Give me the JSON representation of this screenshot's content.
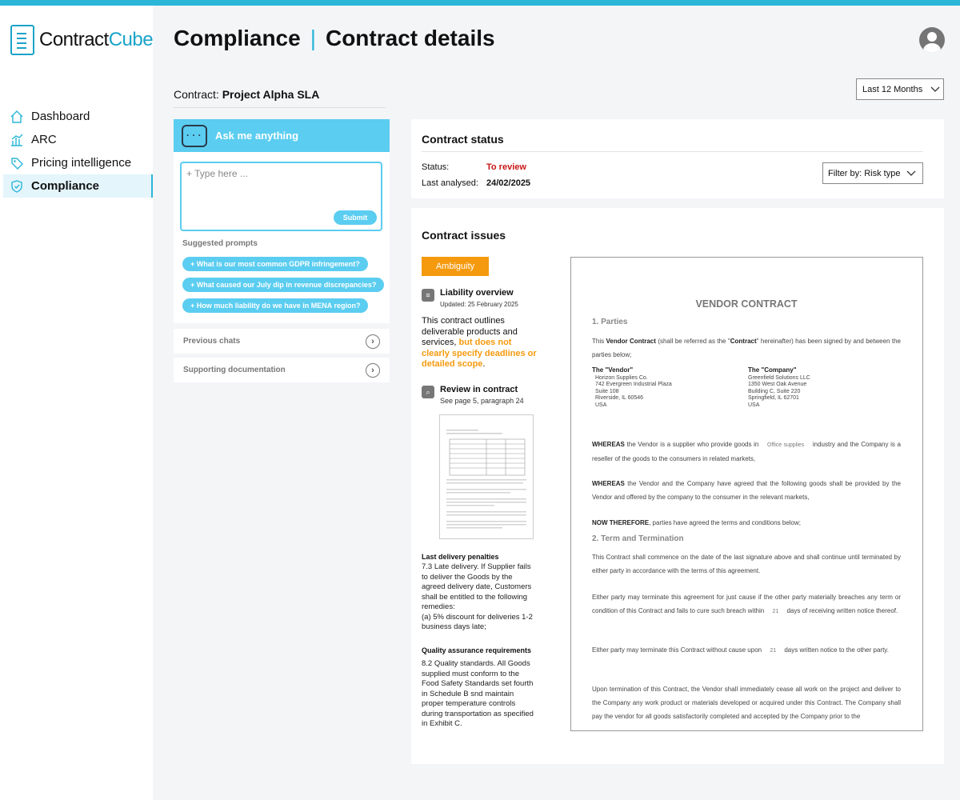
{
  "app": {
    "logo_part1": "Contract",
    "logo_part2": "Cube"
  },
  "sidebar": {
    "items": [
      {
        "label": "Dashboard",
        "icon": "home-icon",
        "active": false
      },
      {
        "label": "ARC",
        "icon": "chart-icon",
        "active": false
      },
      {
        "label": "Pricing intelligence",
        "icon": "price-tag-icon",
        "active": false
      },
      {
        "label": "Compliance",
        "icon": "shield-icon",
        "active": true
      }
    ]
  },
  "header": {
    "title": "Compliance",
    "subtitle": "Contract details",
    "period": "Last 12 Months"
  },
  "contract": {
    "label": "Contract:",
    "name": "Project Alpha SLA"
  },
  "assistant": {
    "title": "Ask me anything",
    "placeholder": "+ Type here ...",
    "submit": "Submit",
    "suggested_label": "Suggested prompts",
    "prompts": [
      "+ What is our most common GDPR infringement?",
      "+ What caused our July dip in revenue discrepancies?",
      "+ How much liability do we have in MENA region?"
    ],
    "previous_chats": "Previous chats",
    "supporting_docs": "Supporting documentation"
  },
  "status": {
    "title": "Contract status",
    "status_label": "Status:",
    "status_value": "To review",
    "analysed_label": "Last analysed:",
    "analysed_value": "24/02/2025",
    "filter": "Filter by: Risk type",
    "status_color": "#c91717"
  },
  "issues": {
    "title": "Contract issues",
    "tag": "Ambiguity",
    "tag_color": "#f59a0e",
    "overview_title": "Liability overview",
    "overview_updated": "Updated: 25 February 2025",
    "overview_text": "This contract outlines deliverable products and services, ",
    "overview_highlight": "but does not clearly specify deadlines or detailed scope",
    "overview_end": ".",
    "review_title": "Review in contract",
    "review_sub": "See page 5, paragraph 24",
    "penalties_title": "Last delivery penalties",
    "penalties_text": "7.3 Late delivery. If Supplier fails to deliver the Goods by the agreed delivery date, Customers shall be entitled to the following remedies:",
    "penalties_item": "(a) 5% discount for deliveries 1-2 business days late;",
    "quality_title": "Quality assurance requirements",
    "quality_text": "8.2 Quality standards. All Goods supplied must conform to the Food Safety Standards set fourth in Schedule B snd maintain proper temperature controls during transportation as specified in Exhibit C."
  },
  "document": {
    "title": "VENDOR CONTRACT",
    "h1": "1. Parties",
    "p1_a": "This ",
    "p1_b": "Vendor Contract",
    "p1_c": " (shall be referred as the \"",
    "p1_d": "Contract",
    "p1_e": "\" hereinafter) has been signed by and between the parties below;",
    "vendor_label": "The \"Vendor\"",
    "vendor_lines": [
      "Horizon Supplies Co.",
      "742 Evergreen Industrial Plaza",
      "Suite 108",
      "Riverside, IL 60546",
      "USA"
    ],
    "company_label": "The \"Company\"",
    "company_lines": [
      "Greenfield Solutions LLC",
      "1350 West Oak Avenue",
      "Building C, Suite 220",
      "Springfield, IL 62701",
      "USA"
    ],
    "w1_bold": "WHEREAS",
    "w1_a": " the Vendor is a supplier who provide goods in ",
    "w1_blank": "Office supplies",
    "w1_b": " industry and the Company is a reseller of the goods to the consumers in related markets,",
    "w2_bold": "WHEREAS",
    "w2_text": " the Vendor and the Company have agreed that the following goods shall be provided by the Vendor and offered by the company to the consumer in the relevant markets,",
    "nt_bold": "NOW THEREFORE",
    "nt_text": ", parties have agreed the terms and conditions below;",
    "h2": "2. Term and Termination",
    "t1": "This Contract shall commence on the date of the last signature above and shall continue until terminated by either party in accordance with the terms of this agreement.",
    "t2_a": "Either party may terminate this agreement for just cause if the other party materially breaches any term or condition of this Contract and fails to cure such breach within ",
    "t2_blank": "21",
    "t2_b": " days of receiving written notice thereof.",
    "t3_a": "Either party may terminate this Contract without cause upon ",
    "t3_blank": "21",
    "t3_b": " days written notice to the other party.",
    "t4": "Upon termination of this Contract, the Vendor shall immediately cease all work on the project and deliver to the Company any work product or materials developed or acquired under this Contract. The Company shall pay the vendor for all goods satisfactorily completed and accepted by the Company prior to the"
  }
}
